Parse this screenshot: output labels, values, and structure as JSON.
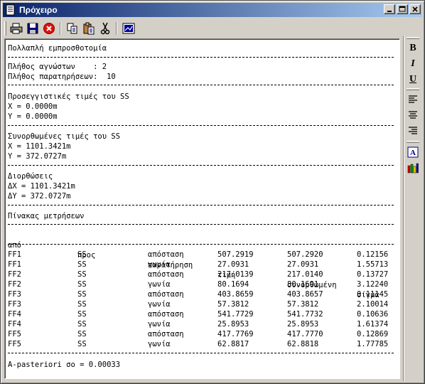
{
  "window": {
    "title": "Πρόχειρο"
  },
  "toolbar": {
    "buttons": [
      "printer-icon",
      "save-icon",
      "stop-icon",
      "copy-icon",
      "paste-icon",
      "cut-icon",
      "image-icon"
    ]
  },
  "sidebar": {
    "bold": "B",
    "italic": "I",
    "underline": "U"
  },
  "report": {
    "header": "Πολλαπλή εμπροσθοτομία",
    "unknowns": "Πλήθος αγνώστων    : 2",
    "observations": "Πλήθος παρατηρήσεων:  10",
    "approx_title": "Προσεγγιστικές τιμές του SS",
    "approx_x": "X = 0.0000m",
    "approx_y": "Y = 0.0000m",
    "adj_title": "Συνορθωμένες τιμές του SS",
    "adj_x": "X = 1101.3421m",
    "adj_y": "Y = 372.0727m",
    "corr_title": "Διορθώσεις",
    "corr_dx": "ΔX = 1101.3421m",
    "corr_dy": "ΔY = 372.0727m",
    "table_title": "Πίνακας μετρήσεων",
    "columns": [
      "από",
      "προς",
      "παρατήρηση",
      "τιμή",
      "συνορθωμένη",
      "σίγμα"
    ],
    "rows": [
      [
        "FF1",
        "SS",
        "απόσταση",
        "507.2919",
        "507.2920",
        "0.12156"
      ],
      [
        "FF1",
        "SS",
        "γωνία",
        "27.0931",
        "27.0931",
        "1.55713"
      ],
      [
        "FF2",
        "SS",
        "απόσταση",
        "217.0139",
        "217.0140",
        "0.13727"
      ],
      [
        "FF2",
        "SS",
        "γωνία",
        "80.1694",
        "80.1691",
        "3.12240"
      ],
      [
        "FF3",
        "SS",
        "απόσταση",
        "403.8659",
        "403.8657",
        "0.11145"
      ],
      [
        "FF3",
        "SS",
        "γωνία",
        "57.3812",
        "57.3812",
        "2.10014"
      ],
      [
        "FF4",
        "SS",
        "απόσταση",
        "541.7729",
        "541.7732",
        "0.10636"
      ],
      [
        "FF4",
        "SS",
        "γωνία",
        "25.8953",
        "25.8953",
        "1.61374"
      ],
      [
        "FF5",
        "SS",
        "απόσταση",
        "417.7769",
        "417.7770",
        "0.12869"
      ],
      [
        "FF5",
        "SS",
        "γωνία",
        "62.8817",
        "62.8818",
        "1.77785"
      ]
    ],
    "footer": "A-pasteriori σο = 0.00033"
  }
}
